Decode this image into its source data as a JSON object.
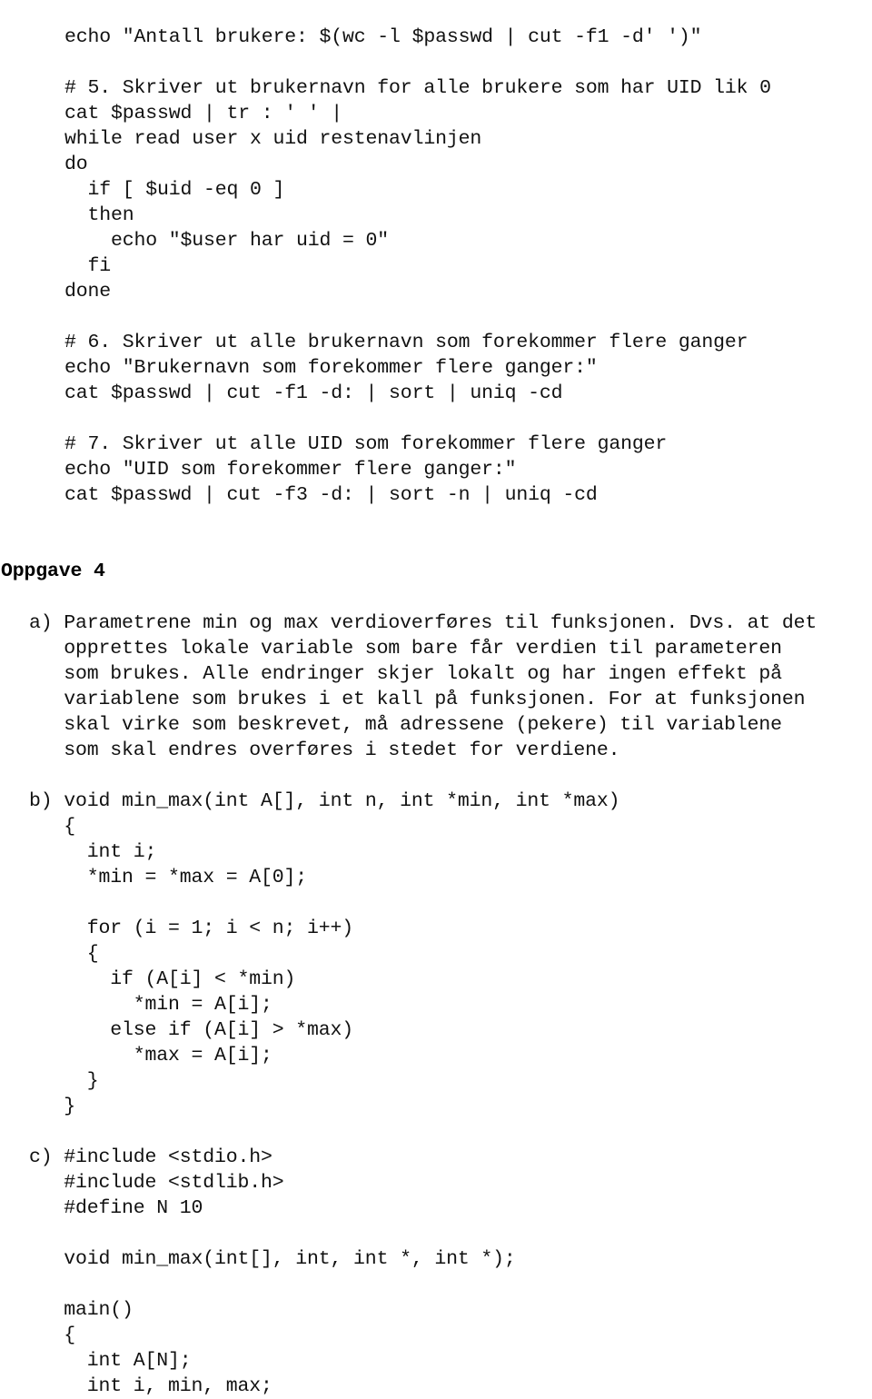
{
  "document": {
    "shell_listing": "echo \"Antall brukere: $(wc -l $passwd | cut -f1 -d' ')\"\n\n# 5. Skriver ut brukernavn for alle brukere som har UID lik 0\ncat $passwd | tr : ' ' |\nwhile read user x uid restenavlinjen\ndo\n  if [ $uid -eq 0 ]\n  then\n    echo \"$user har uid = 0\"\n  fi\ndone\n\n# 6. Skriver ut alle brukernavn som forekommer flere ganger\necho \"Brukernavn som forekommer flere ganger:\"\ncat $passwd | cut -f1 -d: | sort | uniq -cd\n\n# 7. Skriver ut alle UID som forekommer flere ganger\necho \"UID som forekommer flere ganger:\"\ncat $passwd | cut -f3 -d: | sort -n | uniq -cd",
    "heading": "Oppgave 4",
    "items": [
      {
        "label": "a)",
        "text": "Parametrene min og max verdioverføres til funksjonen. Dvs. at det\n   opprettes lokale variable som bare får verdien til parameteren\n   som brukes. Alle endringer skjer lokalt og har ingen effekt på\n   variablene som brukes i et kall på funksjonen. For at funksjonen\n   skal virke som beskrevet, må adressene (pekere) til variablene\n   som skal endres overføres i stedet for verdiene."
      },
      {
        "label": "b)",
        "text": "void min_max(int A[], int n, int *min, int *max)\n   {\n     int i;\n     *min = *max = A[0];\n\n     for (i = 1; i < n; i++)\n     {\n       if (A[i] < *min)\n         *min = A[i];\n       else if (A[i] > *max)\n         *max = A[i];\n     }\n   }"
      },
      {
        "label": "c)",
        "text": "#include <stdio.h>\n   #include <stdlib.h>\n   #define N 10\n\n   void min_max(int[], int, int *, int *);\n\n   main()\n   {\n     int A[N];\n     int i, min, max;"
      }
    ]
  }
}
